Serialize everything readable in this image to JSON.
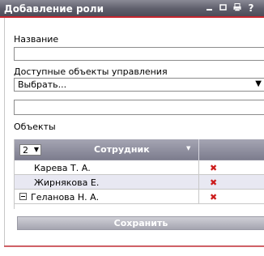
{
  "window": {
    "title": "Добавление роли",
    "controls": [
      "minimize-icon",
      "maximize-icon",
      "print-icon",
      "help-icon"
    ]
  },
  "form": {
    "name_label": "Название",
    "name_value": "",
    "objects_available_label": "Доступные объекты управления",
    "objects_select_value": "Выбрать...",
    "extra_input_value": "",
    "objects_label": "Объекты"
  },
  "grid": {
    "page_value": "2",
    "column_header": "Сотрудник",
    "rows": [
      {
        "name": "Карева Т. А.",
        "expandable": false
      },
      {
        "name": "Жирнякова Е.",
        "expandable": false
      },
      {
        "name": "Геланова Н. А.",
        "expandable": true
      }
    ],
    "delete_icon": "delete-x-icon",
    "delete_color": "#cc1b1b"
  },
  "actions": {
    "save_label": "Сохранить"
  },
  "colors": {
    "accent_line": "#c6262f",
    "header_bg": "#5e5e6b"
  }
}
